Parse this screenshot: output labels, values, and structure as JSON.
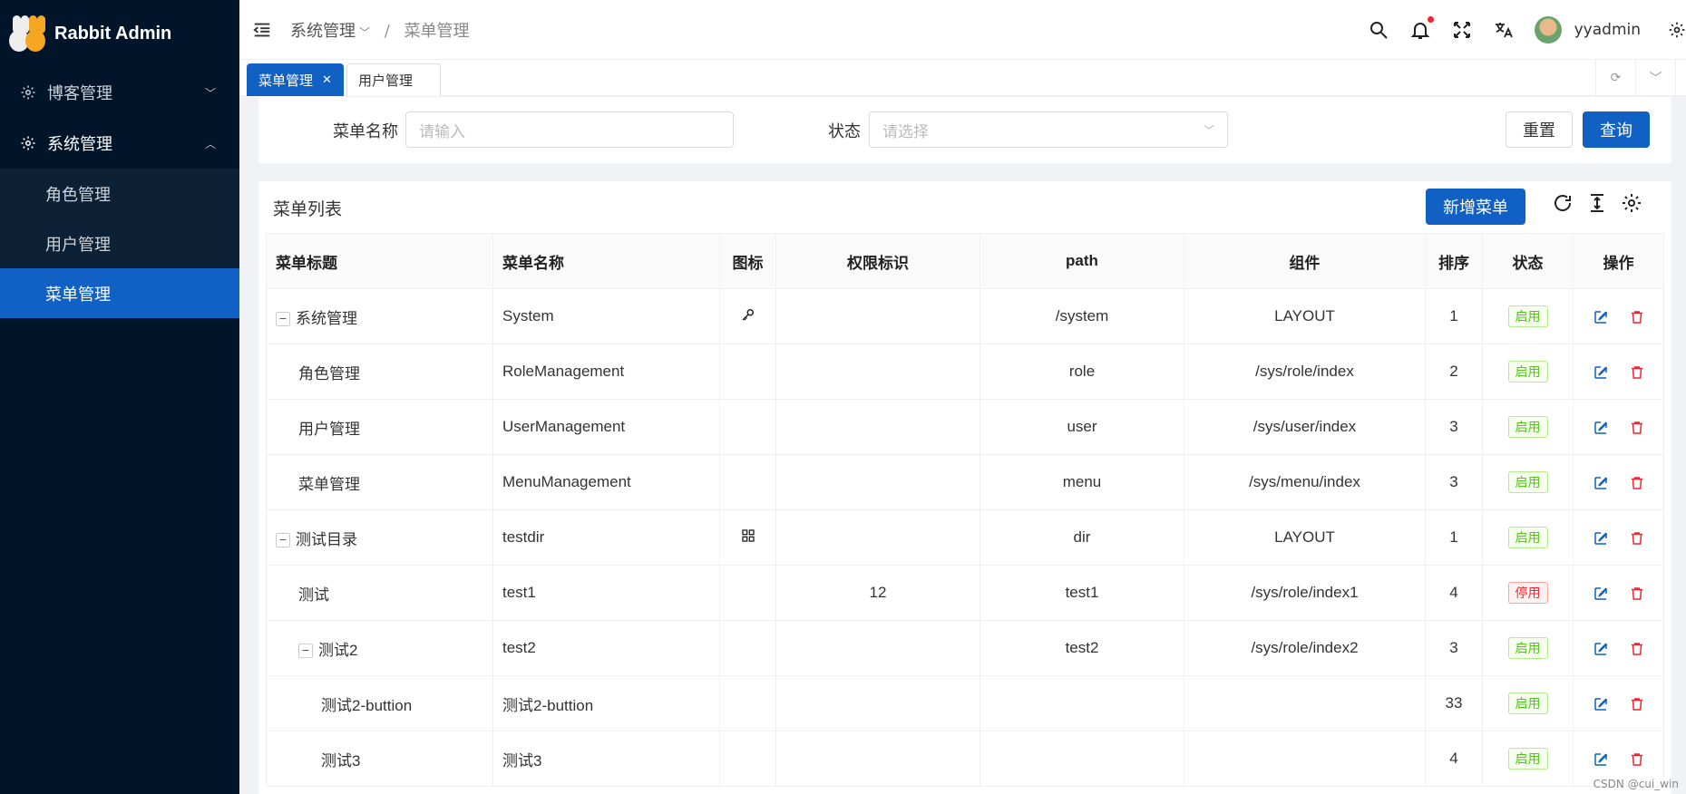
{
  "app": {
    "title": "Rabbit Admin"
  },
  "sidebar": {
    "items": [
      {
        "label": "博客管理",
        "icon": "gear-icon",
        "expanded": false
      },
      {
        "label": "系统管理",
        "icon": "gear-icon",
        "expanded": true,
        "children": [
          {
            "label": "角色管理",
            "active": false
          },
          {
            "label": "用户管理",
            "active": false
          },
          {
            "label": "菜单管理",
            "active": true
          }
        ]
      }
    ]
  },
  "header": {
    "breadcrumb": [
      "系统管理",
      "菜单管理"
    ],
    "username": "yyadmin",
    "icons": [
      "search-icon",
      "bell-icon",
      "fullscreen-icon",
      "translate-icon",
      "avatar",
      "settings-icon"
    ]
  },
  "tabs": [
    {
      "label": "菜单管理",
      "active": true,
      "closable": true
    },
    {
      "label": "用户管理",
      "active": false,
      "closable": false
    }
  ],
  "search": {
    "name_label": "菜单名称",
    "name_placeholder": "请输入",
    "status_label": "状态",
    "status_placeholder": "请选择",
    "reset_label": "重置",
    "query_label": "查询"
  },
  "table": {
    "title": "菜单列表",
    "add_label": "新增菜单",
    "columns": [
      "菜单标题",
      "菜单名称",
      "图标",
      "权限标识",
      "path",
      "组件",
      "排序",
      "状态",
      "操作"
    ],
    "rows": [
      {
        "title": "系统管理",
        "level": 0,
        "expandable": true,
        "name": "System",
        "icon": "key-icon",
        "perm": "",
        "path": "/system",
        "component": "LAYOUT",
        "order": "1",
        "status": "启用",
        "enabled": true
      },
      {
        "title": "角色管理",
        "level": 1,
        "expandable": false,
        "name": "RoleManagement",
        "icon": "",
        "perm": "",
        "path": "role",
        "component": "/sys/role/index",
        "order": "2",
        "status": "启用",
        "enabled": true
      },
      {
        "title": "用户管理",
        "level": 1,
        "expandable": false,
        "name": "UserManagement",
        "icon": "",
        "perm": "",
        "path": "user",
        "component": "/sys/user/index",
        "order": "3",
        "status": "启用",
        "enabled": true
      },
      {
        "title": "菜单管理",
        "level": 1,
        "expandable": false,
        "name": "MenuManagement",
        "icon": "",
        "perm": "",
        "path": "menu",
        "component": "/sys/menu/index",
        "order": "3",
        "status": "启用",
        "enabled": true
      },
      {
        "title": "测试目录",
        "level": 0,
        "expandable": true,
        "name": "testdir",
        "icon": "appstore-icon",
        "perm": "",
        "path": "dir",
        "component": "LAYOUT",
        "order": "1",
        "status": "启用",
        "enabled": true
      },
      {
        "title": "测试",
        "level": 1,
        "expandable": false,
        "name": "test1",
        "icon": "",
        "perm": "12",
        "path": "test1",
        "component": "/sys/role/index1",
        "order": "4",
        "status": "停用",
        "enabled": false
      },
      {
        "title": "测试2",
        "level": 1,
        "expandable": true,
        "name": "test2",
        "icon": "",
        "perm": "",
        "path": "test2",
        "component": "/sys/role/index2",
        "order": "3",
        "status": "启用",
        "enabled": true
      },
      {
        "title": "测试2-buttion",
        "level": 2,
        "expandable": false,
        "name": "测试2-buttion",
        "icon": "",
        "perm": "",
        "path": "",
        "component": "",
        "order": "33",
        "status": "启用",
        "enabled": true
      },
      {
        "title": "测试3",
        "level": 2,
        "expandable": false,
        "name": "测试3",
        "icon": "",
        "perm": "",
        "path": "",
        "component": "",
        "order": "4",
        "status": "启用",
        "enabled": true
      }
    ]
  },
  "watermark_credit": "CSDN @cui_win",
  "colors": {
    "sidebar": "#001529",
    "primary": "#1161c4",
    "success": "#52c41a",
    "danger": "#f5222d"
  }
}
